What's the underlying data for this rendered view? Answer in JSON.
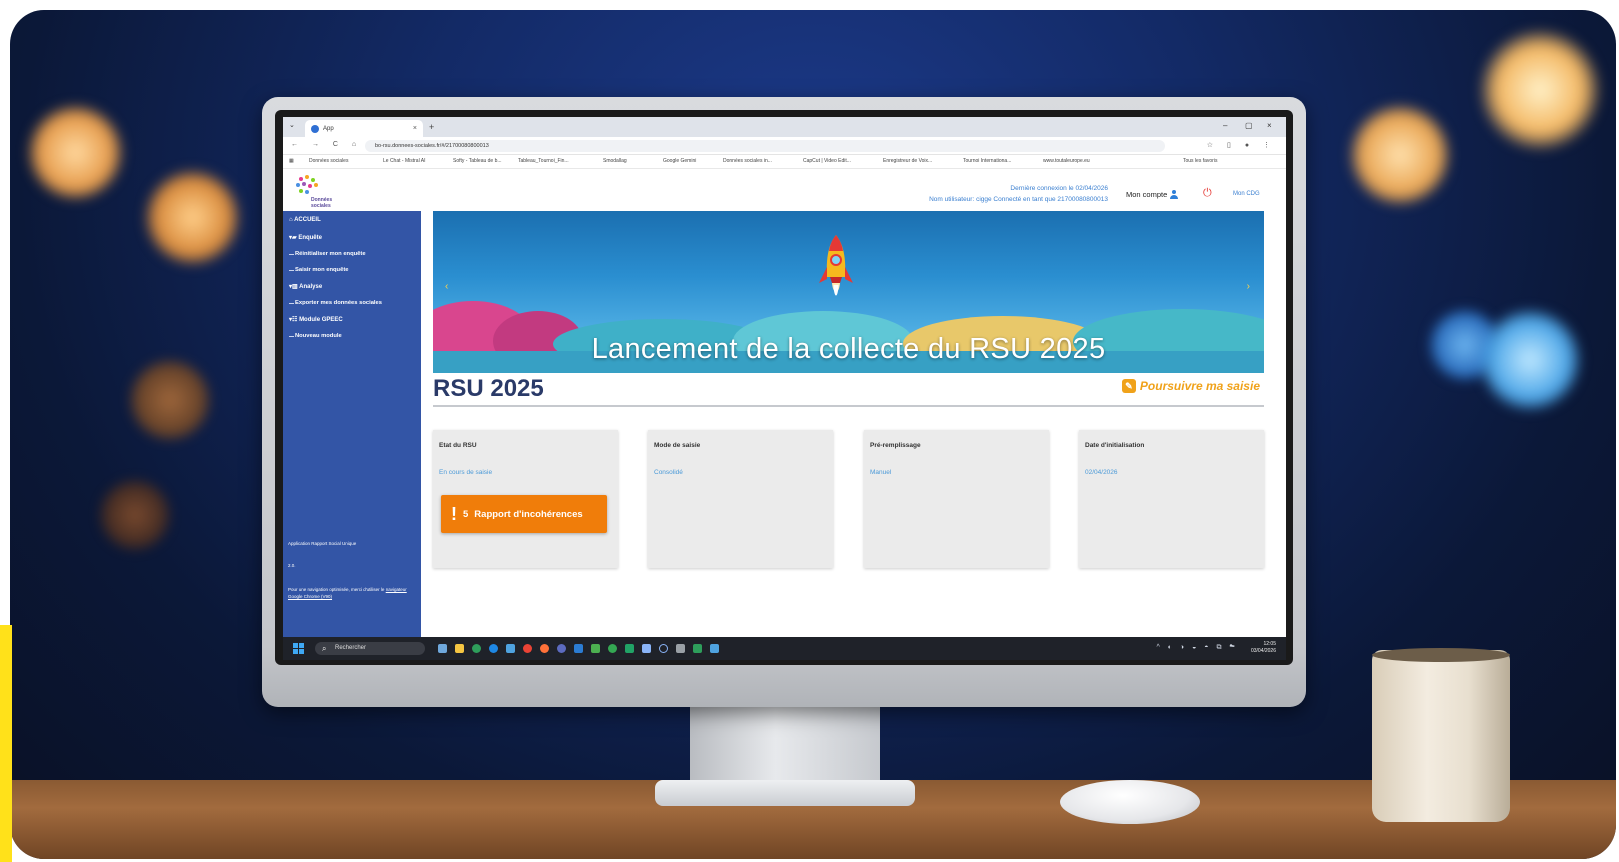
{
  "browser": {
    "tab_title": "App",
    "tab_close": "×",
    "new_tab": "+",
    "window_controls": {
      "minimize": "–",
      "maximize": "▢",
      "close": "×"
    },
    "nav_icons": "← → C ⌂",
    "url": "bo-rsu.donnees-sociales.fr/#/21700080800013",
    "ext_icons": "☆ ▯ ● ⋮",
    "bookmarks": [
      "Données sociales",
      "Le Chat - Mistral AI",
      "Softy - Tableau de b...",
      "Tableau_Tournoi_Fin...",
      "Smodallag",
      "Google Gemini",
      "Données sociales in...",
      "CapCut | Video Edit...",
      "Enregistreur de Voix...",
      "Tournoi Internationa...",
      "www.toutaleurope.eu",
      "Tous les favoris"
    ]
  },
  "header": {
    "logo_text": "Données sociales",
    "last_login": "Dernière connexion le 02/04/2026",
    "user_line": "Nom utilisateur: cigge Connecté en tant que 21700080800013",
    "account_label": "Mon compte",
    "cdg_link": "Mon CDG"
  },
  "sidebar": {
    "home": "ACCUEIL",
    "items": [
      {
        "label": "Enquête",
        "icon": "folder-icon"
      },
      {
        "label": "Réinitialiser mon enquête",
        "sub": true
      },
      {
        "label": "Saisir mon enquête",
        "sub": true
      },
      {
        "label": "Analyse",
        "icon": "chart-icon"
      },
      {
        "label": "Exporter mes données sociales",
        "sub": true
      },
      {
        "label": "Module GPEEC",
        "icon": "people-icon"
      },
      {
        "label": "Nouveau module",
        "sub": true
      }
    ],
    "footer_title": "Application Rapport Social Unique",
    "footer_version": "2.0.",
    "footer_note": "Pour une navigation optimisée, merci d'utiliser le",
    "footer_link": "navigateur Google Chrome (V90)"
  },
  "banner": {
    "title": "Lancement de la collecte du RSU 2025",
    "prev": "‹",
    "next": "›"
  },
  "main": {
    "page_title": "RSU 2025",
    "continue_label": "Poursuivre ma saisie",
    "cards": [
      {
        "label": "Etat du RSU",
        "value": "En cours de saisie"
      },
      {
        "label": "Mode de saisie",
        "value": "Consolidé"
      },
      {
        "label": "Pré-remplissage",
        "value": "Manuel"
      },
      {
        "label": "Date d'initialisation",
        "value": "02/04/2026"
      }
    ],
    "incoherence_button": {
      "count": "5",
      "label": "Rapport d'incohérences",
      "icon": "!"
    }
  },
  "taskbar": {
    "search_placeholder": "Rechercher",
    "tray_icons": "^ ◐ ◑ ◒ ◓ ⧉ ☁",
    "time": "12:05",
    "date": "03/04/2026"
  },
  "colors": {
    "sidebar": "#3355a6",
    "accent_orange": "#f07d0a",
    "link_blue": "#3a7fd0",
    "title_navy": "#2a3a68"
  }
}
